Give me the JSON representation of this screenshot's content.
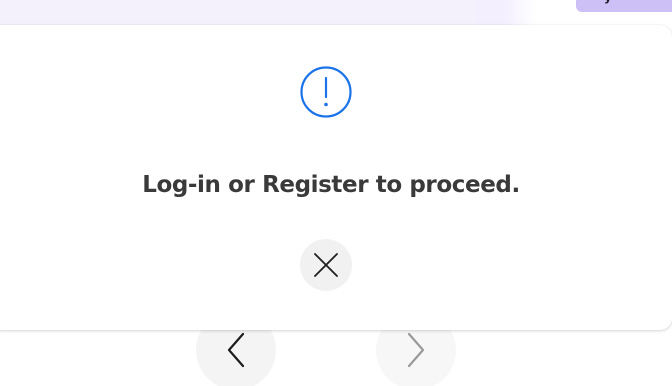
{
  "modal": {
    "icon": "alert-circle-icon",
    "message": "Log-in or Register to proceed.",
    "close_icon": "close-icon",
    "accent_color": "#1a73e8"
  },
  "background": {
    "prev_icon": "chevron-left-icon",
    "next_icon": "chevron-right-icon",
    "chip_color": "#ccc0f6",
    "band_color": "#f4f1fd"
  }
}
